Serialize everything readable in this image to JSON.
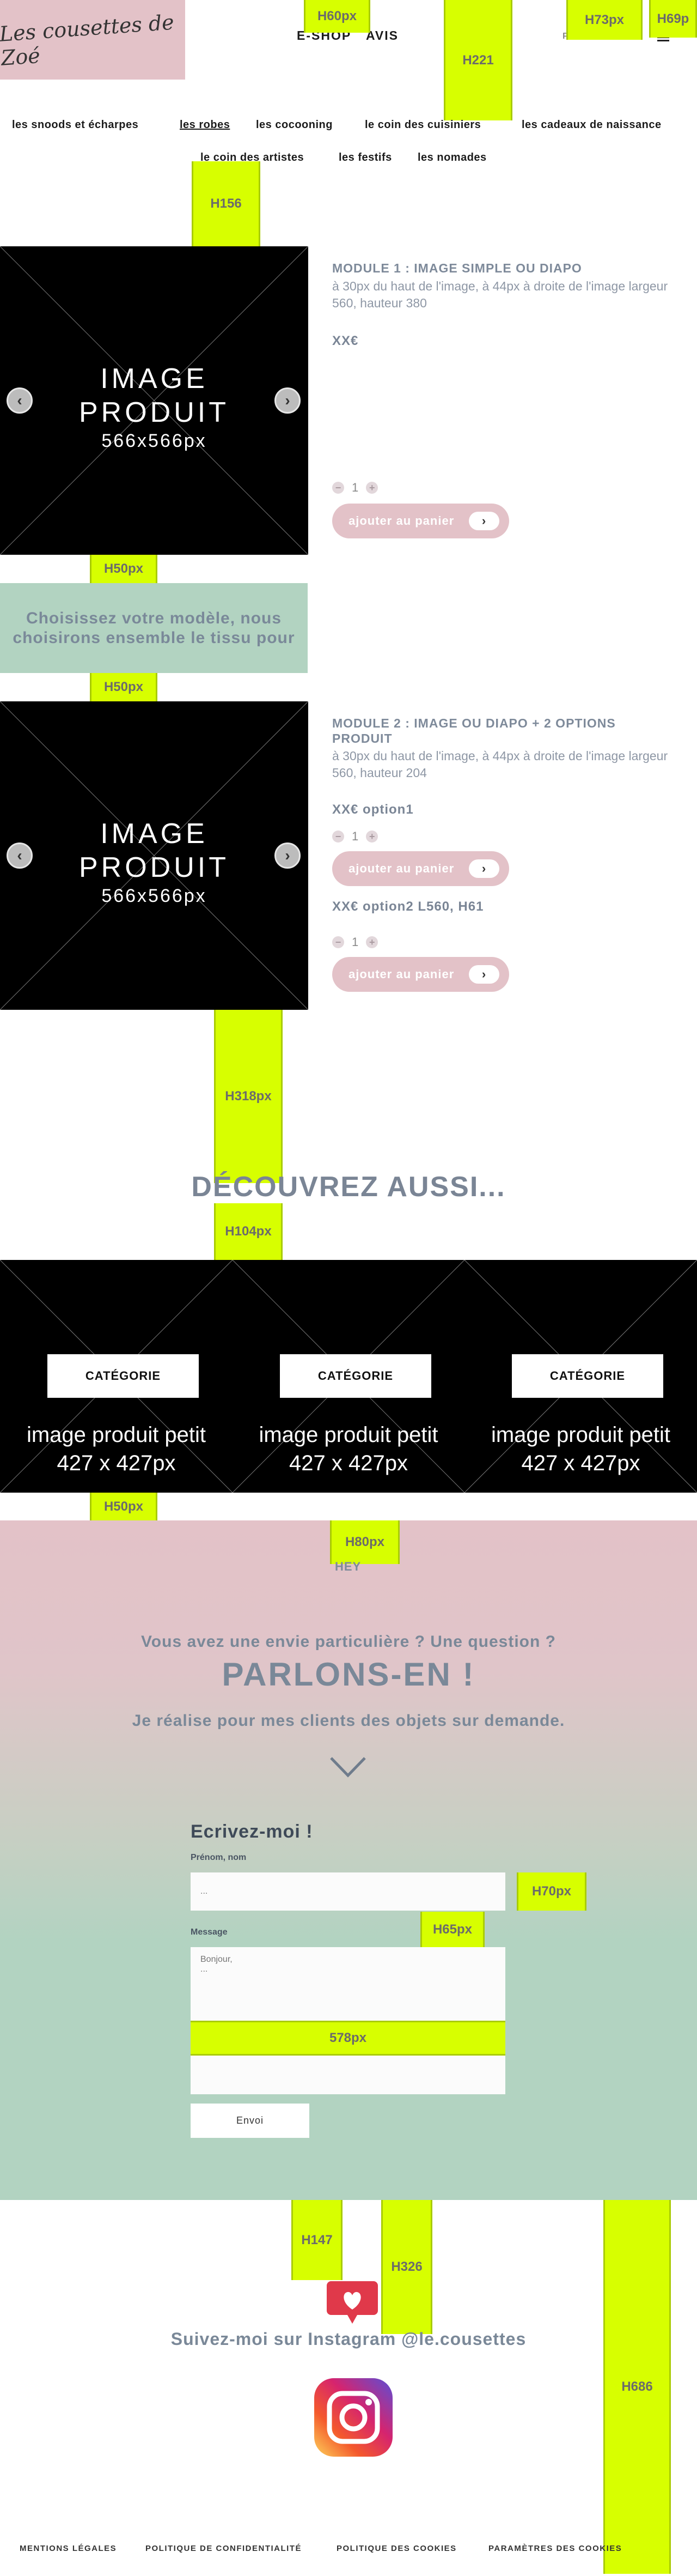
{
  "header": {
    "logo_text": "Les cousettes de Zoé",
    "nav": [
      "E-SHOP",
      "AVIS"
    ],
    "panier": "PANIER",
    "categories_row1": [
      "les snoods et écharpes",
      "les robes",
      "les cocooning",
      "le coin des cuisiniers",
      "les cadeaux de naissance"
    ],
    "categories_row2": [
      "le coin des artistes",
      "les festifs",
      "les nomades"
    ]
  },
  "specs": {
    "h60": "H60px",
    "h221": "H221",
    "h73": "H73px",
    "h69": "H69p",
    "h156": "H156",
    "h50a": "H50px",
    "h50b": "H50px",
    "h318": "H318px",
    "h104": "H104px",
    "h50c": "H50px",
    "h80": "H80px",
    "h70": "H70px",
    "h65": "H65px",
    "w578": "578px",
    "h147": "H147",
    "h326": "H326",
    "h686": "H686"
  },
  "module1": {
    "image_line1": "IMAGE",
    "image_line2": "PRODUIT",
    "image_size": "566x566px",
    "title": "MODULE 1 : IMAGE SIMPLE OU DIAPO",
    "desc": "à 30px du haut de l'image, à 44px à droite de l'image largeur 560, hauteur 380",
    "price": "XX€",
    "qty": "1",
    "cart": "ajouter au panier"
  },
  "choose": "Choisissez votre modèle, nous choisirons ensemble le tissu pour",
  "module2": {
    "image_line1": "IMAGE",
    "image_line2": "PRODUIT",
    "image_size": "566x566px",
    "title": "MODULE 2 : IMAGE OU DIAPO + 2 OPTIONS PRODUIT",
    "desc": "à 30px du haut de l'image, à 44px à droite de l'image largeur 560, hauteur 204",
    "option1_price": "XX€ option1",
    "option1_qty": "1",
    "option1_cart": "ajouter au panier",
    "option2_price": "XX€ option2 L560, H61",
    "option2_qty": "1",
    "option2_cart": "ajouter au panier"
  },
  "discover": "DÉCOUVREZ AUSSI...",
  "categories_cards": [
    {
      "button": "CATÉGORIE",
      "line1": "image produit petit",
      "line2": "427 x 427px"
    },
    {
      "button": "CATÉGORIE",
      "line1": "image produit petit",
      "line2": "427 x 427px"
    },
    {
      "button": "CATÉGORIE",
      "line1": "image produit petit",
      "line2": "427 x 427px"
    }
  ],
  "contact": {
    "hey": "HEY",
    "question": "Vous avez une envie particulière ? Une question ?",
    "headline": "PARLONS-EN !",
    "subline": "Je réalise pour mes clients des objets sur demande.",
    "form_title": "Ecrivez-moi !",
    "name_label": "Prénom, nom",
    "name_placeholder": "...",
    "message_label": "Message",
    "message_placeholder": "Bonjour,\n...",
    "send": "Envoi"
  },
  "instagram": {
    "text": "Suivez-moi sur Instagram @le.cousettes"
  },
  "footer": [
    "MENTIONS LÉGALES",
    "POLITIQUE DE CONFIDENTIALITÉ",
    "POLITIQUE DES COOKIES",
    "PARAMÈTRES DES COOKIES"
  ],
  "colors": {
    "pink": "#e3c2c8",
    "mint": "#b2d3c1",
    "spec_yellow": "#d7ff00",
    "text_slate": "#7a8898"
  }
}
